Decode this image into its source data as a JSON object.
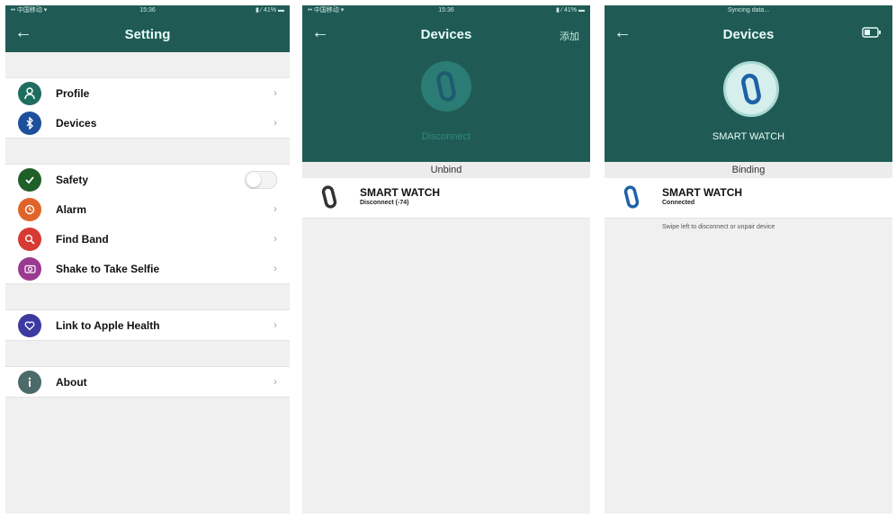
{
  "screen1": {
    "status": {
      "left": "•• 中国移动 ▾",
      "time": "15:36",
      "right": "▮ ⁄ 41% ▬"
    },
    "title": "Setting",
    "groups": [
      {
        "items": [
          {
            "label": "Profile",
            "icon": "person-icon",
            "color": "#1f6d5f"
          },
          {
            "label": "Devices",
            "icon": "bluetooth-icon",
            "color": "#1d4f9c"
          }
        ]
      },
      {
        "items": [
          {
            "label": "Safety",
            "icon": "shield-check-icon",
            "color": "#1f5f2a"
          },
          {
            "label": "Alarm",
            "icon": "alarm-clock-icon",
            "color": "#e0642a"
          },
          {
            "label": "Find Band",
            "icon": "magnifier-icon",
            "color": "#d63a34"
          },
          {
            "label": "Shake to Take Selfie",
            "icon": "camera-icon",
            "color": "#9a3a91"
          }
        ]
      },
      {
        "items": [
          {
            "label": "Link to Apple Health",
            "icon": "health-icon",
            "color": "#3c3aa0"
          }
        ]
      },
      {
        "items": [
          {
            "label": "About",
            "icon": "info-icon",
            "color": "#4c6a6a"
          }
        ]
      }
    ]
  },
  "screen2": {
    "status": {
      "left": "•• 中国移动 ▾",
      "time": "15:36",
      "right": "▮ ⁄ 41% ▬"
    },
    "title": "Devices",
    "header_right": "添加",
    "header_sub": "Disconnect",
    "section": "Unbind",
    "device_name": "SMART WATCH",
    "device_status": "Disconnect (-74)"
  },
  "screen3": {
    "status_center": "Syncing data...",
    "title": "Devices",
    "header_sub": "SMART WATCH",
    "section": "Binding",
    "device_name": "SMART WATCH",
    "device_status": "Connected",
    "hint": "Swipe left to disconnect or unpair device"
  },
  "colors": {
    "header": "#1f5b54",
    "background": "#f0f0f0"
  }
}
